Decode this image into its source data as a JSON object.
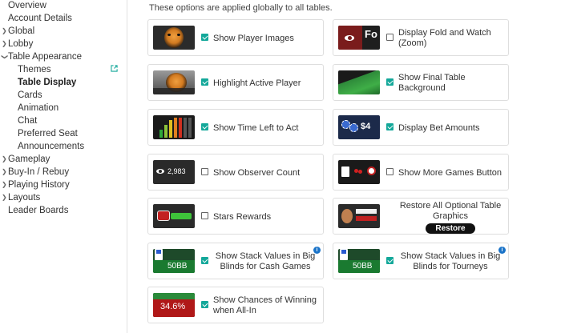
{
  "sidebar": {
    "items": [
      {
        "label": "Overview",
        "chev": false,
        "indent": false,
        "active": false
      },
      {
        "label": "Account Details",
        "chev": false,
        "indent": false,
        "active": false
      },
      {
        "label": "Global",
        "chev": true,
        "indent": false,
        "active": false
      },
      {
        "label": "Lobby",
        "chev": true,
        "indent": false,
        "active": false
      },
      {
        "label": "Table Appearance",
        "chev": true,
        "indent": false,
        "active": false
      },
      {
        "label": "Themes",
        "chev": false,
        "indent": true,
        "active": false
      },
      {
        "label": "Table Display",
        "chev": false,
        "indent": true,
        "active": true
      },
      {
        "label": "Cards",
        "chev": false,
        "indent": true,
        "active": false
      },
      {
        "label": "Animation",
        "chev": false,
        "indent": true,
        "active": false
      },
      {
        "label": "Chat",
        "chev": false,
        "indent": true,
        "active": false
      },
      {
        "label": "Preferred Seat",
        "chev": false,
        "indent": true,
        "active": false
      },
      {
        "label": "Announcements",
        "chev": false,
        "indent": true,
        "active": false
      },
      {
        "label": "Gameplay",
        "chev": true,
        "indent": false,
        "active": false
      },
      {
        "label": "Buy-In / Rebuy",
        "chev": true,
        "indent": false,
        "active": false
      },
      {
        "label": "Playing History",
        "chev": true,
        "indent": false,
        "active": false
      },
      {
        "label": "Layouts",
        "chev": true,
        "indent": false,
        "active": false
      },
      {
        "label": "Leader Boards",
        "chev": false,
        "indent": false,
        "active": false
      }
    ]
  },
  "main": {
    "intro": "These options are applied globally to all tables.",
    "options": [
      {
        "label": "Show Player Images",
        "checked": true,
        "thumb": "tiger-avatar",
        "thumb_text": ""
      },
      {
        "label": "Display Fold and Watch (Zoom)",
        "checked": false,
        "thumb": "fold-watch",
        "thumb_text": "Fo"
      },
      {
        "label": "Highlight Active Player",
        "checked": true,
        "thumb": "tiger-active",
        "thumb_text": ""
      },
      {
        "label": "Show Final Table Background",
        "checked": true,
        "thumb": "green-felt",
        "thumb_text": ""
      },
      {
        "label": "Show Time Left to Act",
        "checked": true,
        "thumb": "time-bars",
        "thumb_text": ""
      },
      {
        "label": "Display Bet Amounts",
        "checked": true,
        "thumb": "chips-bet",
        "thumb_text": "$4"
      },
      {
        "label": "Show Observer Count",
        "checked": false,
        "thumb": "observer",
        "thumb_text": "2,983"
      },
      {
        "label": "Show More Games Button",
        "checked": false,
        "thumb": "more-games",
        "thumb_text": ""
      },
      {
        "label": "Stars Rewards",
        "checked": false,
        "thumb": "stars-rewards",
        "thumb_text": ""
      },
      {
        "label": "Restore All Optional Table Graphics",
        "checked": false,
        "thumb": "restore-graphics",
        "thumb_text": "",
        "button": "Restore"
      },
      {
        "label": "Show Stack Values in Big Blinds for Cash Games",
        "checked": true,
        "thumb": "stack-bb",
        "thumb_text": "50BB",
        "info": true
      },
      {
        "label": "Show Stack Values in Big Blinds for Tourneys",
        "checked": true,
        "thumb": "stack-bb",
        "thumb_text": "50BB",
        "info": true
      },
      {
        "label": "Show Chances of Winning when All-In",
        "checked": true,
        "thumb": "win-chance",
        "thumb_text": "34.6%"
      }
    ]
  },
  "colors": {
    "accent": "#14a89a",
    "info": "#1a73c8",
    "border": "#dedede"
  }
}
